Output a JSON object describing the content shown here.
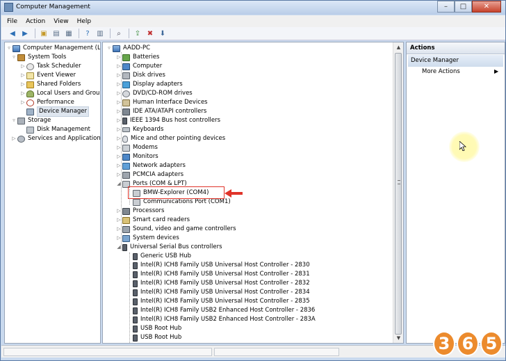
{
  "window": {
    "title": "Computer Management"
  },
  "menu": [
    "File",
    "Action",
    "View",
    "Help"
  ],
  "toolbar": {
    "buttons": [
      "back-icon",
      "forward-icon",
      "up-icon",
      "show-hide-tree-icon",
      "properties-icon",
      "help-icon",
      "console-tree-icon",
      "scan-hardware-icon",
      "update-driver-icon",
      "uninstall-icon",
      "disable-icon"
    ]
  },
  "left_tree": [
    {
      "label": "Computer Management (Local",
      "icon": "computer-icon",
      "level": 0,
      "expander": "▿"
    },
    {
      "label": "System Tools",
      "icon": "tool-icon",
      "level": 1,
      "expander": "▿"
    },
    {
      "label": "Task Scheduler",
      "icon": "clock-icon",
      "level": 2,
      "expander": "▷"
    },
    {
      "label": "Event Viewer",
      "icon": "log-icon",
      "level": 2,
      "expander": "▷"
    },
    {
      "label": "Shared Folders",
      "icon": "folder-icon",
      "level": 2,
      "expander": "▷"
    },
    {
      "label": "Local Users and Groups",
      "icon": "users-icon",
      "level": 2,
      "expander": "▷"
    },
    {
      "label": "Performance",
      "icon": "performance-icon",
      "level": 2,
      "expander": "▷"
    },
    {
      "label": "Device Manager",
      "icon": "device-manager-icon",
      "level": 2,
      "expander": "",
      "selected": true
    },
    {
      "label": "Storage",
      "icon": "storage-icon",
      "level": 1,
      "expander": "▿"
    },
    {
      "label": "Disk Management",
      "icon": "disk-icon",
      "level": 2,
      "expander": ""
    },
    {
      "label": "Services and Applications",
      "icon": "services-icon",
      "level": 1,
      "expander": "▷"
    }
  ],
  "device_tree": {
    "root": "AADD-PC",
    "categories": [
      {
        "label": "Batteries",
        "icon": "battery-icon"
      },
      {
        "label": "Computer",
        "icon": "computer-icon"
      },
      {
        "label": "Disk drives",
        "icon": "drive-icon"
      },
      {
        "label": "Display adapters",
        "icon": "display-icon"
      },
      {
        "label": "DVD/CD-ROM drives",
        "icon": "dvd-icon"
      },
      {
        "label": "Human Interface Devices",
        "icon": "hid-icon"
      },
      {
        "label": "IDE ATA/ATAPI controllers",
        "icon": "ide-icon"
      },
      {
        "label": "IEEE 1394 Bus host controllers",
        "icon": "usb-plug-icon"
      },
      {
        "label": "Keyboards",
        "icon": "keyboard-icon"
      },
      {
        "label": "Mice and other pointing devices",
        "icon": "mouse-icon"
      },
      {
        "label": "Modems",
        "icon": "modem-icon"
      },
      {
        "label": "Monitors",
        "icon": "monitor-icon"
      },
      {
        "label": "Network adapters",
        "icon": "network-icon"
      },
      {
        "label": "PCMCIA adapters",
        "icon": "pcmcia-icon"
      },
      {
        "label": "Ports (COM & LPT)",
        "icon": "port-icon",
        "expanded": true
      },
      {
        "label": "Processors",
        "icon": "cpu-icon"
      },
      {
        "label": "Smart card readers",
        "icon": "smart-card-icon"
      },
      {
        "label": "Sound, video and game controllers",
        "icon": "sound-icon"
      },
      {
        "label": "System devices",
        "icon": "system-icon"
      },
      {
        "label": "Universal Serial Bus controllers",
        "icon": "usb-plug-icon",
        "expanded": true
      }
    ],
    "ports_children": [
      "BMW-Explorer (COM4)",
      "Communications Port (COM1)"
    ],
    "usb_children": [
      "Generic USB Hub",
      "Intel(R) ICH8 Family USB Universal Host Controller - 2830",
      "Intel(R) ICH8 Family USB Universal Host Controller - 2831",
      "Intel(R) ICH8 Family USB Universal Host Controller - 2832",
      "Intel(R) ICH8 Family USB Universal Host Controller - 2834",
      "Intel(R) ICH8 Family USB Universal Host Controller - 2835",
      "Intel(R) ICH8 Family USB2 Enhanced Host Controller - 2836",
      "Intel(R) ICH8 Family USB2 Enhanced Host Controller - 283A",
      "USB Root Hub",
      "USB Root Hub"
    ]
  },
  "actions": {
    "header": "Actions",
    "section": "Device Manager",
    "more": "More Actions"
  },
  "annotation_color": "#e0342a",
  "watermark": {
    "digits": [
      "3",
      "6",
      "5"
    ]
  }
}
